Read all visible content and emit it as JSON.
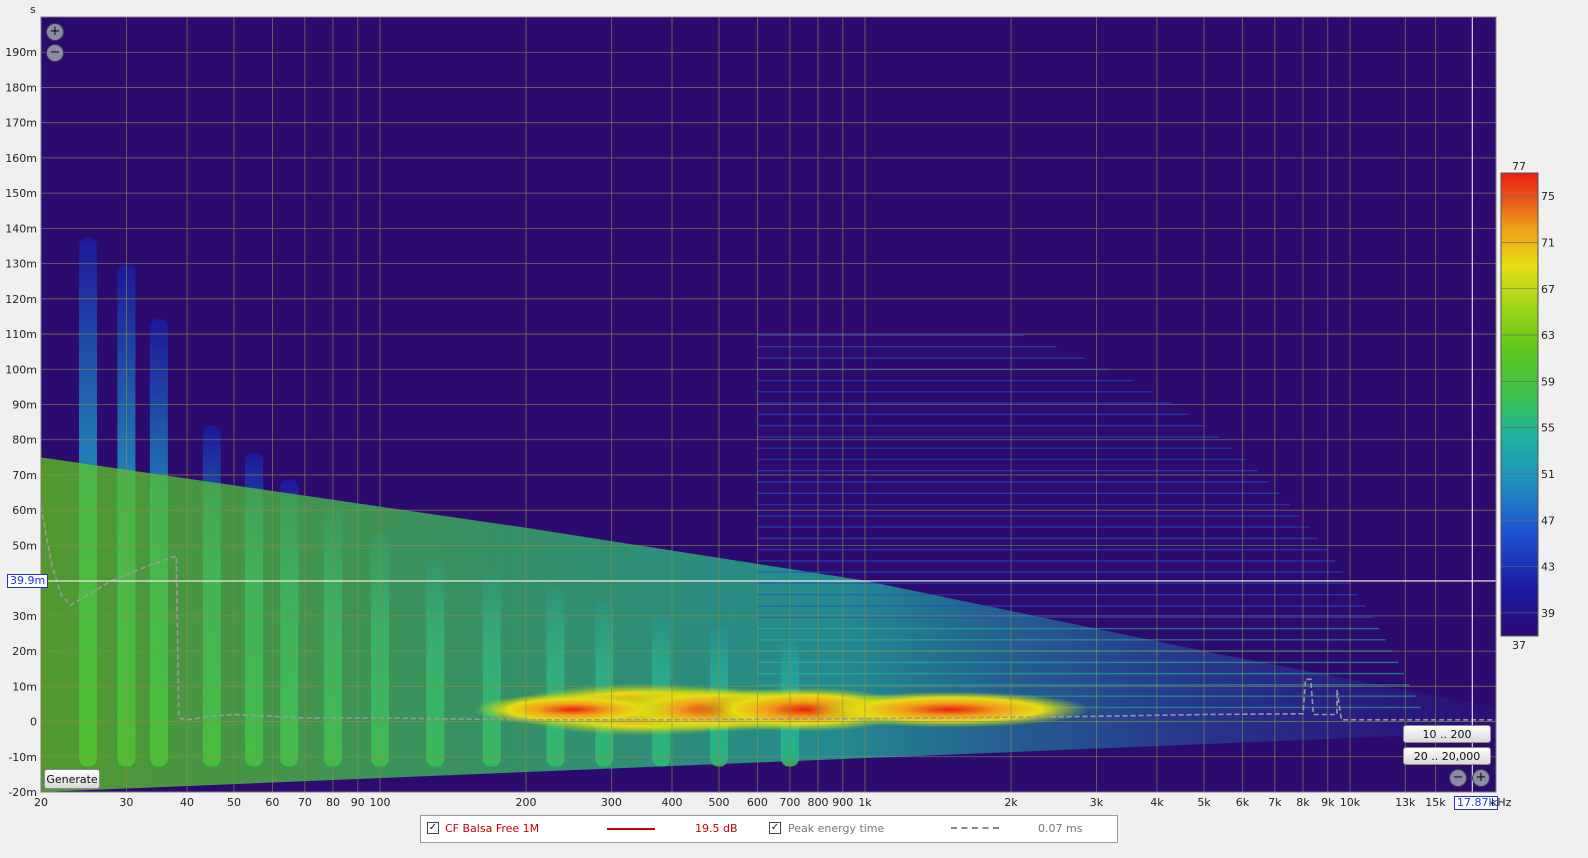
{
  "app": {
    "y_unit": "s",
    "x_unit": "kHz"
  },
  "buttons": {
    "generate": "Generate",
    "range_time": "10 .. 200",
    "range_freq": "20 .. 20,000"
  },
  "markers": {
    "time": "39.9m",
    "freq": "17.87k"
  },
  "legend": [
    {
      "name": "CF Balsa Free 1M",
      "value": "19.5 dB",
      "color": "#cc0000",
      "style": "solid"
    },
    {
      "name": "Peak energy time",
      "value": "0.07 ms",
      "color": "#888888",
      "style": "dashed"
    }
  ],
  "colors": {
    "plot_background": "#2d0a6e",
    "accent_marker": "#2233cc"
  },
  "chart_data": {
    "type": "heatmap",
    "title": "",
    "xlabel": "kHz",
    "ylabel": "s",
    "x_scale": "log",
    "xlim": [
      20,
      20000
    ],
    "ylim": [
      -0.02,
      0.2
    ],
    "grid": true,
    "x_ticks": [
      {
        "v": 20,
        "label": "20"
      },
      {
        "v": 30,
        "label": "30"
      },
      {
        "v": 40,
        "label": "40"
      },
      {
        "v": 50,
        "label": "50"
      },
      {
        "v": 60,
        "label": "60"
      },
      {
        "v": 70,
        "label": "70"
      },
      {
        "v": 80,
        "label": "80"
      },
      {
        "v": 90,
        "label": "90"
      },
      {
        "v": 100,
        "label": "100"
      },
      {
        "v": 200,
        "label": "200"
      },
      {
        "v": 300,
        "label": "300"
      },
      {
        "v": 400,
        "label": "400"
      },
      {
        "v": 500,
        "label": "500"
      },
      {
        "v": 600,
        "label": "600"
      },
      {
        "v": 700,
        "label": "700"
      },
      {
        "v": 800,
        "label": "800"
      },
      {
        "v": 900,
        "label": "900"
      },
      {
        "v": 1000,
        "label": "1k"
      },
      {
        "v": 2000,
        "label": "2k"
      },
      {
        "v": 3000,
        "label": "3k"
      },
      {
        "v": 4000,
        "label": "4k"
      },
      {
        "v": 5000,
        "label": "5k"
      },
      {
        "v": 6000,
        "label": "6k"
      },
      {
        "v": 7000,
        "label": "7k"
      },
      {
        "v": 8000,
        "label": "8k"
      },
      {
        "v": 9000,
        "label": "9k"
      },
      {
        "v": 10000,
        "label": "10k"
      },
      {
        "v": 13000,
        "label": "13k"
      },
      {
        "v": 15000,
        "label": "15k"
      }
    ],
    "y_ticks": [
      {
        "v": 0.19,
        "label": "190m"
      },
      {
        "v": 0.18,
        "label": "180m"
      },
      {
        "v": 0.17,
        "label": "170m"
      },
      {
        "v": 0.16,
        "label": "160m"
      },
      {
        "v": 0.15,
        "label": "150m"
      },
      {
        "v": 0.14,
        "label": "140m"
      },
      {
        "v": 0.13,
        "label": "130m"
      },
      {
        "v": 0.12,
        "label": "120m"
      },
      {
        "v": 0.11,
        "label": "110m"
      },
      {
        "v": 0.1,
        "label": "100m"
      },
      {
        "v": 0.09,
        "label": "90m"
      },
      {
        "v": 0.08,
        "label": "80m"
      },
      {
        "v": 0.07,
        "label": "70m"
      },
      {
        "v": 0.06,
        "label": "60m"
      },
      {
        "v": 0.05,
        "label": "50m"
      },
      {
        "v": 0.04,
        "label": "40m"
      },
      {
        "v": 0.03,
        "label": "30m"
      },
      {
        "v": 0.02,
        "label": "20m"
      },
      {
        "v": 0.01,
        "label": "10m"
      },
      {
        "v": 0,
        "label": "0"
      },
      {
        "v": -0.01,
        "label": "-10m"
      },
      {
        "v": -0.02,
        "label": "-20m"
      }
    ],
    "colorbar": {
      "min": 37,
      "max": 77,
      "ticks": [
        39,
        43,
        47,
        51,
        55,
        59,
        63,
        67,
        71,
        75
      ],
      "min_label": "37",
      "max_label": "77",
      "colors": [
        "#2d0a6e",
        "#1a1aa0",
        "#1e50d0",
        "#1f8fc0",
        "#20b59a",
        "#3cc04a",
        "#5dc81a",
        "#a8d51b",
        "#e7dc14",
        "#f0a01a",
        "#e85a1a",
        "#e8200f"
      ]
    },
    "series": [
      {
        "name": "Peak energy time",
        "points": [
          [
            20,
            0.061
          ],
          [
            21,
            0.045
          ],
          [
            22,
            0.036
          ],
          [
            23,
            0.033
          ],
          [
            25,
            0.036
          ],
          [
            28,
            0.04
          ],
          [
            33,
            0.044
          ],
          [
            38,
            0.047
          ],
          [
            38.5,
            0.001
          ],
          [
            40,
            0.0005
          ],
          [
            45,
            0.0015
          ],
          [
            50,
            0.002
          ],
          [
            60,
            0.0015
          ],
          [
            70,
            0.001
          ],
          [
            100,
            0.001
          ],
          [
            200,
            0.0005
          ],
          [
            400,
            0.0005
          ],
          [
            1000,
            0.0008
          ],
          [
            2000,
            0.0012
          ],
          [
            3000,
            0.0015
          ],
          [
            5000,
            0.002
          ],
          [
            8000,
            0.0022
          ],
          [
            8100,
            0.012
          ],
          [
            8300,
            0.012
          ],
          [
            8400,
            0.002
          ],
          [
            9400,
            0.002
          ],
          [
            9400,
            0.009
          ],
          [
            9600,
            0.0005
          ],
          [
            20000,
            0.0005
          ]
        ]
      }
    ],
    "cursor": {
      "time": 0.0399,
      "freq": 17870
    }
  }
}
